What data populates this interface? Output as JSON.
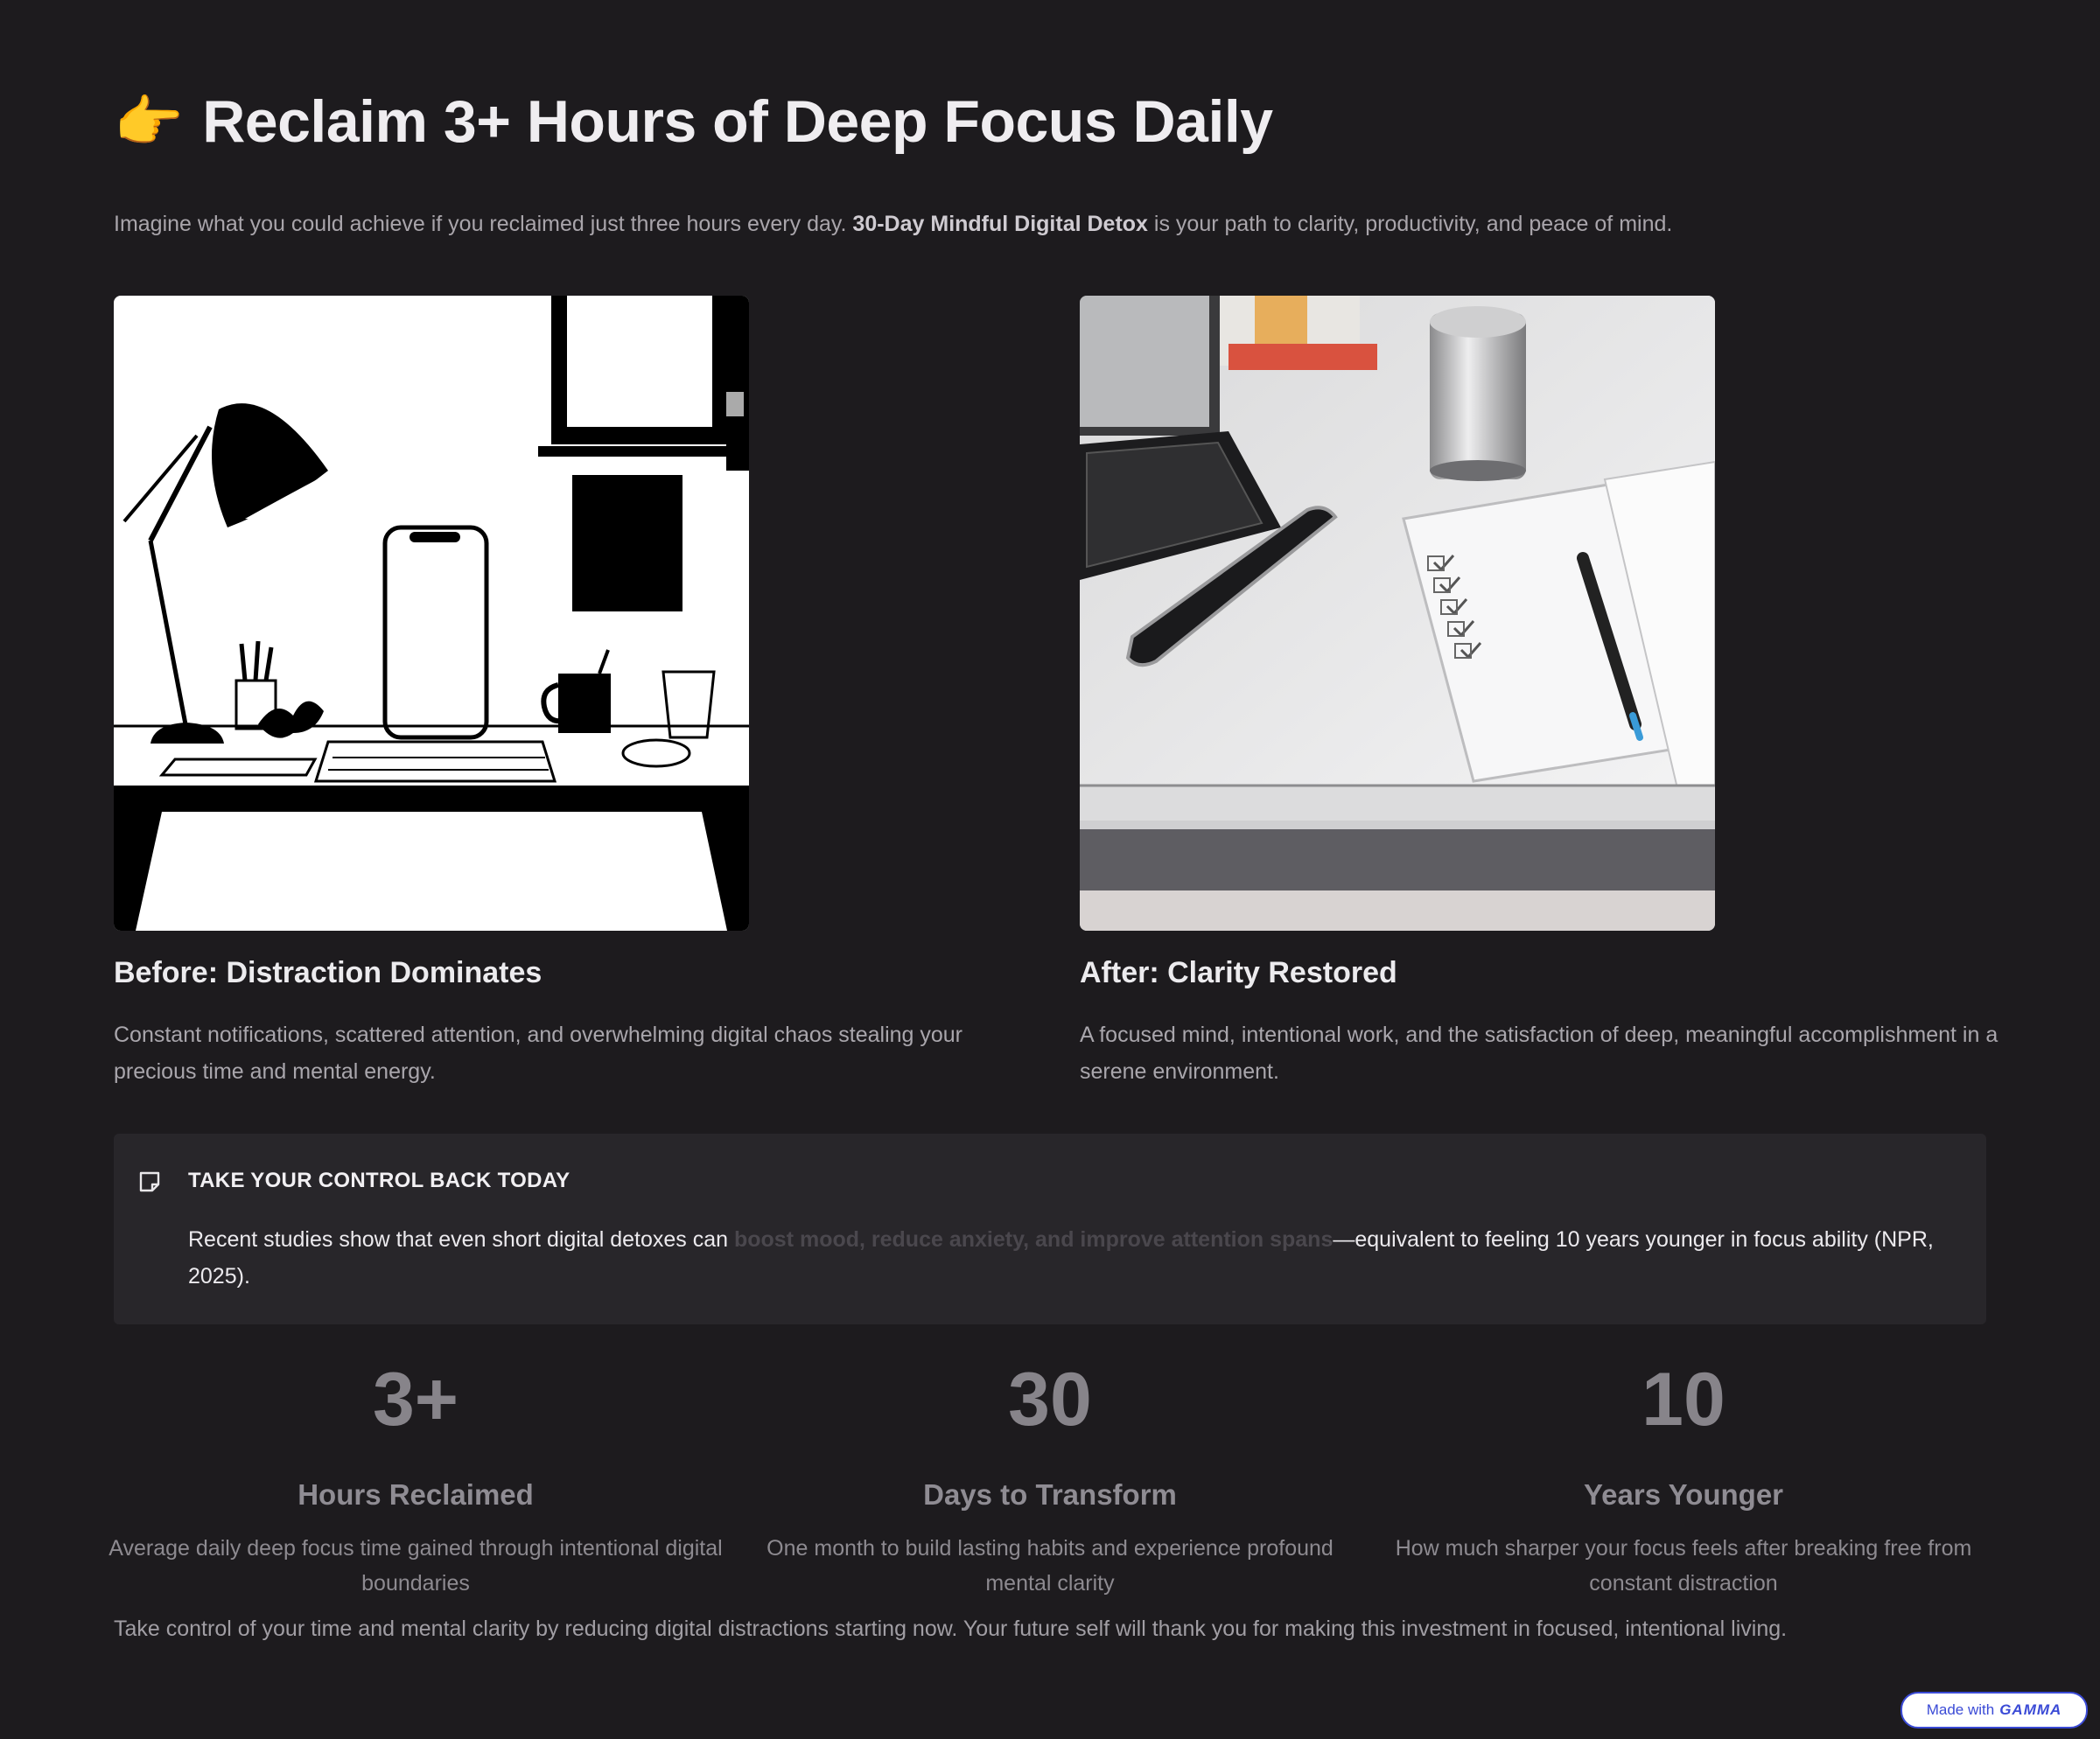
{
  "header": {
    "emoji": "👉",
    "title": "Reclaim 3+ Hours of Deep Focus Daily",
    "intro_pre": "Imagine what you could achieve if you reclaimed just three hours every day. ",
    "intro_bold": "30-Day Mindful Digital Detox",
    "intro_post": " is your path to clarity, productivity, and peace of mind."
  },
  "before": {
    "title": "Before: Distraction Dominates",
    "text": "Constant notifications, scattered attention, and overwhelming digital chaos stealing your precious time and mental energy."
  },
  "after": {
    "title": "After: Clarity Restored",
    "text": "A focused mind, intentional work, and the satisfaction of deep, meaningful accomplishment in a serene environment."
  },
  "callout": {
    "heading": "TAKE YOUR CONTROL BACK TODAY",
    "body_pre": "Recent studies show that even short digital detoxes can ",
    "body_highlight": "boost mood, reduce anxiety, and improve attention spans",
    "body_post": "—equivalent to feeling 10 years younger in focus ability (NPR, 2025)."
  },
  "stats": [
    {
      "number": "3+",
      "label": "Hours Reclaimed",
      "desc": "Average daily deep focus time gained through intentional digital boundaries"
    },
    {
      "number": "30",
      "label": "Days to Transform",
      "desc": "One month to build lasting habits and experience profound mental clarity"
    },
    {
      "number": "10",
      "label": "Years Younger",
      "desc": "How much sharper your focus feels after breaking free from constant distraction"
    }
  ],
  "closing": "Take control of your time and mental clarity by reducing digital distractions starting now. Your future self will thank you for making this investment in focused, intentional living.",
  "badge": {
    "made_with": "Made with",
    "brand": "GAMMA"
  },
  "colors": {
    "background": "#1d1b1e",
    "callout_bg": "#28262a",
    "badge_accent": "#3b4bd6"
  }
}
